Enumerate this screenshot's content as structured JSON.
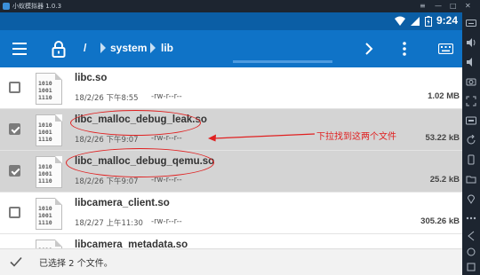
{
  "emulator": {
    "title": "小蚁模拟器 1.0.3",
    "controls": [
      "≡",
      "—",
      "□",
      "✕"
    ],
    "sidebar_icons": [
      "keyboard-icon",
      "volume-up-icon",
      "volume-down-icon",
      "screenshot-icon",
      "fullscreen-icon",
      "apk-icon",
      "rotate-icon",
      "shake-icon",
      "folder-icon",
      "location-icon",
      "more-icon",
      "back-icon",
      "home-icon",
      "recents-icon"
    ]
  },
  "status_bar": {
    "time": "9:24",
    "icons": [
      "wifi-icon",
      "signal-icon",
      "battery-icon"
    ]
  },
  "toolbar": {
    "root": "/",
    "crumbs": [
      "system",
      "lib"
    ],
    "icons": [
      "menu-icon",
      "lock-icon",
      "forward-icon",
      "more-vert-icon",
      "keyboard-icon"
    ]
  },
  "files": [
    {
      "name": "libc.so",
      "date": "18/2/26 下午8:55",
      "perm": "-rw-r--r--",
      "size": "1.02 MB",
      "selected": false,
      "bits": [
        "1010",
        "1001",
        "1110"
      ]
    },
    {
      "name": "libc_malloc_debug_leak.so",
      "date": "18/2/26 下午9:07",
      "perm": "-rw-r--r--",
      "size": "53.22 kB",
      "selected": true,
      "bits": [
        "1010",
        "1001",
        "1110"
      ]
    },
    {
      "name": "libc_malloc_debug_qemu.so",
      "date": "18/2/26 下午9:07",
      "perm": "-rw-r--r--",
      "size": "25.2 kB",
      "selected": true,
      "bits": [
        "1010",
        "1001",
        "1110"
      ]
    },
    {
      "name": "libcamera_client.so",
      "date": "18/2/27 上午11:30",
      "perm": "-rw-r--r--",
      "size": "305.26 kB",
      "selected": false,
      "bits": [
        "1010",
        "1001",
        "1110"
      ]
    },
    {
      "name": "libcamera_metadata.so",
      "date": "",
      "perm": "",
      "size": "",
      "selected": false,
      "bits": [
        "1010",
        "1001",
        "1110"
      ]
    }
  ],
  "annotation": {
    "text": "下拉找到这两个文件",
    "color": "#e02020"
  },
  "action_bar": {
    "selection_text": "已选择 2 个文件。"
  },
  "colors": {
    "toolbar": "#0f73c7",
    "status_bar": "#0b5ea5",
    "selected_row": "#d4d4d4"
  }
}
